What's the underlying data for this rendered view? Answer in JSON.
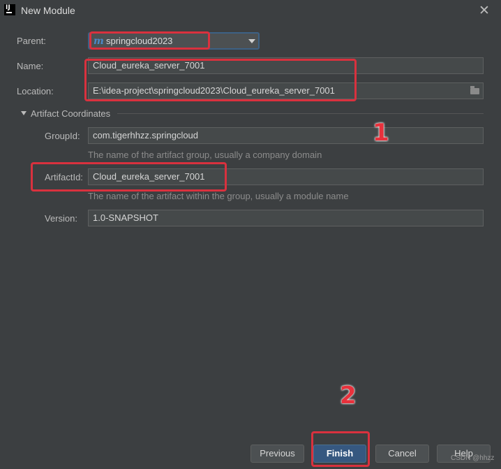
{
  "window": {
    "title": "New Module",
    "icon_text": "IJ",
    "close_glyph": "✕"
  },
  "form": {
    "parent": {
      "label": "Parent:",
      "value": "springcloud2023",
      "icon": "m"
    },
    "name": {
      "label": "Name:",
      "value": "Cloud_eureka_server_7001"
    },
    "location": {
      "label": "Location:",
      "value": "E:\\idea-project\\springcloud2023\\Cloud_eureka_server_7001"
    }
  },
  "artifact": {
    "section_title": "Artifact Coordinates",
    "group_id": {
      "label": "GroupId:",
      "value": "com.tigerhhzz.springcloud",
      "hint": "The name of the artifact group, usually a company domain"
    },
    "artifact_id": {
      "label": "ArtifactId:",
      "value": "Cloud_eureka_server_7001",
      "hint": "The name of the artifact within the group, usually a module name"
    },
    "version": {
      "label": "Version:",
      "value": "1.0-SNAPSHOT"
    }
  },
  "annotations": {
    "step1": "1",
    "step2": "2",
    "highlight_color": "#d9313e"
  },
  "buttons": {
    "previous": "Previous",
    "finish": "Finish",
    "cancel": "Cancel",
    "help": "Help"
  },
  "watermark": "CSDN @hhzz",
  "colors": {
    "background": "#3c3f41",
    "primary_button": "#365880",
    "annotation_red": "#e8313c"
  }
}
